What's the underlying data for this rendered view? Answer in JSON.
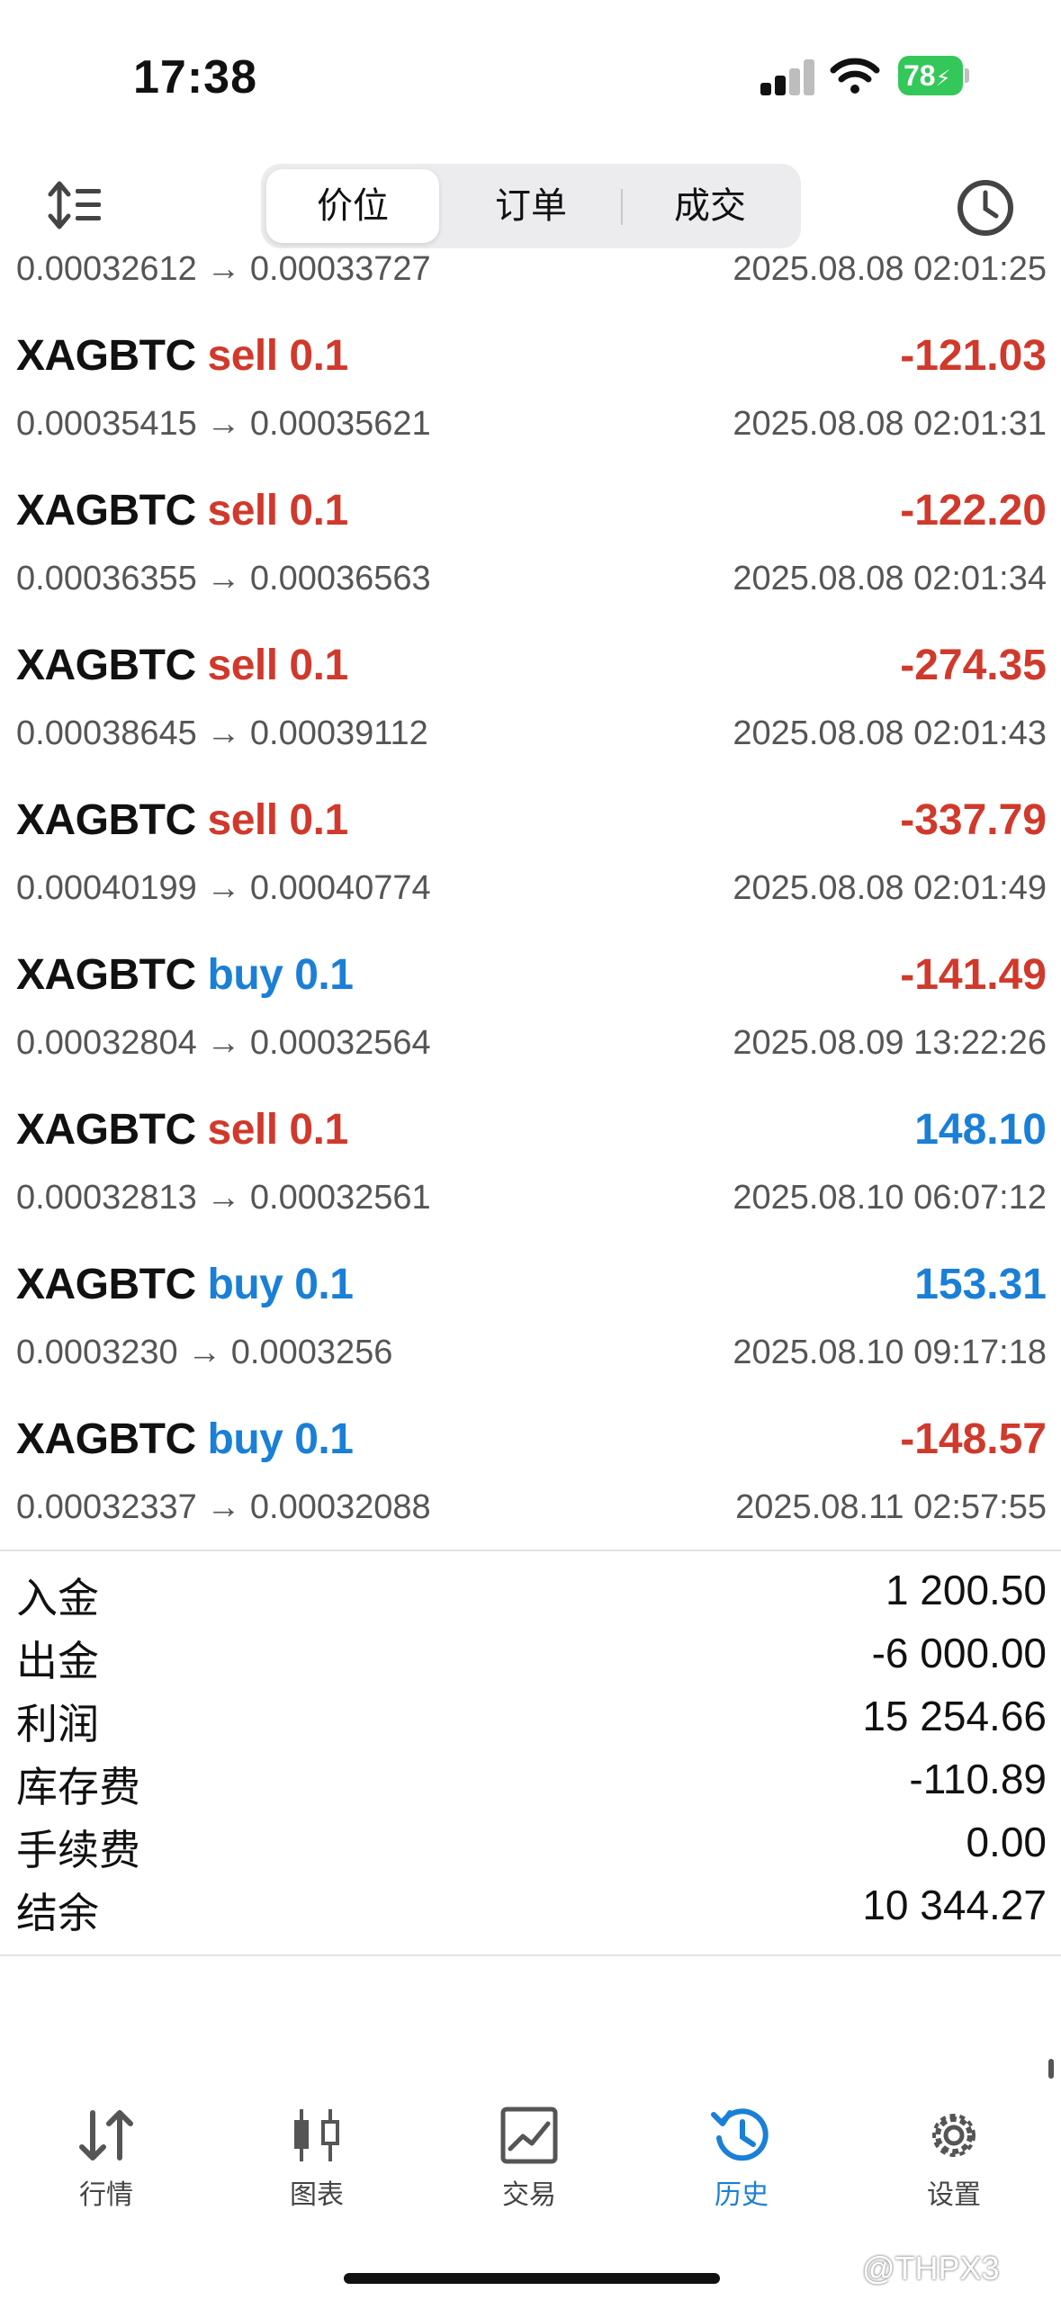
{
  "status_bar": {
    "time": "17:38",
    "battery": "78"
  },
  "toolbar": {
    "tabs": [
      {
        "label": "价位",
        "active": true
      },
      {
        "label": "订单",
        "active": false
      },
      {
        "label": "成交",
        "active": false
      }
    ]
  },
  "partial_row": {
    "prices": "0.00032612 → 0.00033727",
    "time": "2025.08.08 02:01:25"
  },
  "trades": [
    {
      "symbol": "XAGBTC",
      "side": "sell",
      "volume": "0.1",
      "profit": "-121.03",
      "prices": "0.00035415 → 0.00035621",
      "time": "2025.08.08 02:01:31"
    },
    {
      "symbol": "XAGBTC",
      "side": "sell",
      "volume": "0.1",
      "profit": "-122.20",
      "prices": "0.00036355 → 0.00036563",
      "time": "2025.08.08 02:01:34"
    },
    {
      "symbol": "XAGBTC",
      "side": "sell",
      "volume": "0.1",
      "profit": "-274.35",
      "prices": "0.00038645 → 0.00039112",
      "time": "2025.08.08 02:01:43"
    },
    {
      "symbol": "XAGBTC",
      "side": "sell",
      "volume": "0.1",
      "profit": "-337.79",
      "prices": "0.00040199 → 0.00040774",
      "time": "2025.08.08 02:01:49"
    },
    {
      "symbol": "XAGBTC",
      "side": "buy",
      "volume": "0.1",
      "profit": "-141.49",
      "prices": "0.00032804 → 0.00032564",
      "time": "2025.08.09 13:22:26"
    },
    {
      "symbol": "XAGBTC",
      "side": "sell",
      "volume": "0.1",
      "profit": "148.10",
      "prices": "0.00032813 → 0.00032561",
      "time": "2025.08.10 06:07:12"
    },
    {
      "symbol": "XAGBTC",
      "side": "buy",
      "volume": "0.1",
      "profit": "153.31",
      "prices": "0.0003230 → 0.0003256",
      "time": "2025.08.10 09:17:18"
    },
    {
      "symbol": "XAGBTC",
      "side": "buy",
      "volume": "0.1",
      "profit": "-148.57",
      "prices": "0.00032337 → 0.00032088",
      "time": "2025.08.11 02:57:55"
    }
  ],
  "summary": [
    {
      "label": "入金",
      "value": "1 200.50"
    },
    {
      "label": "出金",
      "value": "-6 000.00"
    },
    {
      "label": "利润",
      "value": "15 254.66"
    },
    {
      "label": "库存费",
      "value": "-110.89"
    },
    {
      "label": "手续费",
      "value": "0.00"
    },
    {
      "label": "结余",
      "value": "10 344.27"
    }
  ],
  "tabbar": [
    {
      "label": "行情",
      "icon": "arrows-updown-icon",
      "active": false
    },
    {
      "label": "图表",
      "icon": "candlestick-icon",
      "active": false
    },
    {
      "label": "交易",
      "icon": "line-chart-icon",
      "active": false
    },
    {
      "label": "历史",
      "icon": "history-icon",
      "active": true
    },
    {
      "label": "设置",
      "icon": "gear-icon",
      "active": false
    }
  ],
  "watermark": "@THPX3",
  "colors": {
    "sell": "#d0392b",
    "buy": "#1a7fd6",
    "active_tab": "#1a7fd6"
  }
}
